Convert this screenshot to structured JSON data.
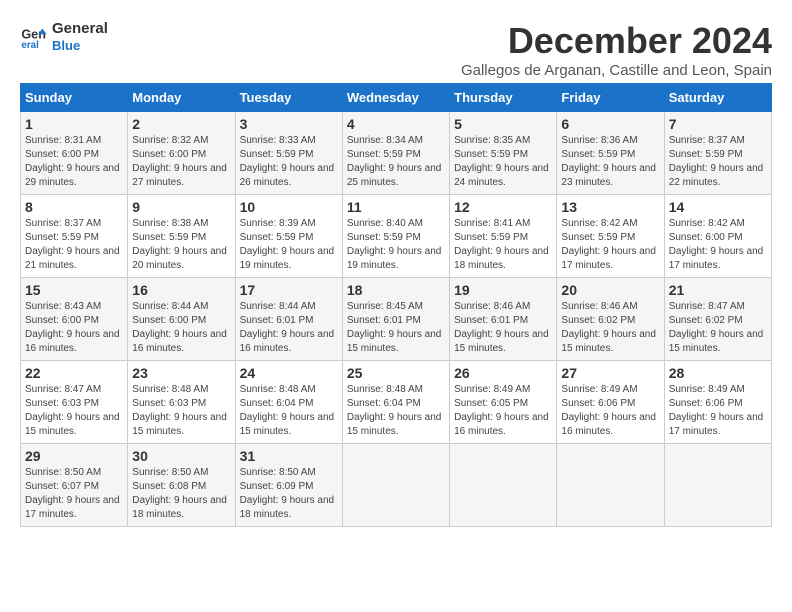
{
  "logo": {
    "line1": "General",
    "line2": "Blue"
  },
  "title": "December 2024",
  "subtitle": "Gallegos de Arganan, Castille and Leon, Spain",
  "weekdays": [
    "Sunday",
    "Monday",
    "Tuesday",
    "Wednesday",
    "Thursday",
    "Friday",
    "Saturday"
  ],
  "weeks": [
    [
      {
        "day": "1",
        "sunrise": "Sunrise: 8:31 AM",
        "sunset": "Sunset: 6:00 PM",
        "daylight": "Daylight: 9 hours and 29 minutes."
      },
      {
        "day": "2",
        "sunrise": "Sunrise: 8:32 AM",
        "sunset": "Sunset: 6:00 PM",
        "daylight": "Daylight: 9 hours and 27 minutes."
      },
      {
        "day": "3",
        "sunrise": "Sunrise: 8:33 AM",
        "sunset": "Sunset: 5:59 PM",
        "daylight": "Daylight: 9 hours and 26 minutes."
      },
      {
        "day": "4",
        "sunrise": "Sunrise: 8:34 AM",
        "sunset": "Sunset: 5:59 PM",
        "daylight": "Daylight: 9 hours and 25 minutes."
      },
      {
        "day": "5",
        "sunrise": "Sunrise: 8:35 AM",
        "sunset": "Sunset: 5:59 PM",
        "daylight": "Daylight: 9 hours and 24 minutes."
      },
      {
        "day": "6",
        "sunrise": "Sunrise: 8:36 AM",
        "sunset": "Sunset: 5:59 PM",
        "daylight": "Daylight: 9 hours and 23 minutes."
      },
      {
        "day": "7",
        "sunrise": "Sunrise: 8:37 AM",
        "sunset": "Sunset: 5:59 PM",
        "daylight": "Daylight: 9 hours and 22 minutes."
      }
    ],
    [
      {
        "day": "8",
        "sunrise": "Sunrise: 8:37 AM",
        "sunset": "Sunset: 5:59 PM",
        "daylight": "Daylight: 9 hours and 21 minutes."
      },
      {
        "day": "9",
        "sunrise": "Sunrise: 8:38 AM",
        "sunset": "Sunset: 5:59 PM",
        "daylight": "Daylight: 9 hours and 20 minutes."
      },
      {
        "day": "10",
        "sunrise": "Sunrise: 8:39 AM",
        "sunset": "Sunset: 5:59 PM",
        "daylight": "Daylight: 9 hours and 19 minutes."
      },
      {
        "day": "11",
        "sunrise": "Sunrise: 8:40 AM",
        "sunset": "Sunset: 5:59 PM",
        "daylight": "Daylight: 9 hours and 19 minutes."
      },
      {
        "day": "12",
        "sunrise": "Sunrise: 8:41 AM",
        "sunset": "Sunset: 5:59 PM",
        "daylight": "Daylight: 9 hours and 18 minutes."
      },
      {
        "day": "13",
        "sunrise": "Sunrise: 8:42 AM",
        "sunset": "Sunset: 5:59 PM",
        "daylight": "Daylight: 9 hours and 17 minutes."
      },
      {
        "day": "14",
        "sunrise": "Sunrise: 8:42 AM",
        "sunset": "Sunset: 6:00 PM",
        "daylight": "Daylight: 9 hours and 17 minutes."
      }
    ],
    [
      {
        "day": "15",
        "sunrise": "Sunrise: 8:43 AM",
        "sunset": "Sunset: 6:00 PM",
        "daylight": "Daylight: 9 hours and 16 minutes."
      },
      {
        "day": "16",
        "sunrise": "Sunrise: 8:44 AM",
        "sunset": "Sunset: 6:00 PM",
        "daylight": "Daylight: 9 hours and 16 minutes."
      },
      {
        "day": "17",
        "sunrise": "Sunrise: 8:44 AM",
        "sunset": "Sunset: 6:01 PM",
        "daylight": "Daylight: 9 hours and 16 minutes."
      },
      {
        "day": "18",
        "sunrise": "Sunrise: 8:45 AM",
        "sunset": "Sunset: 6:01 PM",
        "daylight": "Daylight: 9 hours and 15 minutes."
      },
      {
        "day": "19",
        "sunrise": "Sunrise: 8:46 AM",
        "sunset": "Sunset: 6:01 PM",
        "daylight": "Daylight: 9 hours and 15 minutes."
      },
      {
        "day": "20",
        "sunrise": "Sunrise: 8:46 AM",
        "sunset": "Sunset: 6:02 PM",
        "daylight": "Daylight: 9 hours and 15 minutes."
      },
      {
        "day": "21",
        "sunrise": "Sunrise: 8:47 AM",
        "sunset": "Sunset: 6:02 PM",
        "daylight": "Daylight: 9 hours and 15 minutes."
      }
    ],
    [
      {
        "day": "22",
        "sunrise": "Sunrise: 8:47 AM",
        "sunset": "Sunset: 6:03 PM",
        "daylight": "Daylight: 9 hours and 15 minutes."
      },
      {
        "day": "23",
        "sunrise": "Sunrise: 8:48 AM",
        "sunset": "Sunset: 6:03 PM",
        "daylight": "Daylight: 9 hours and 15 minutes."
      },
      {
        "day": "24",
        "sunrise": "Sunrise: 8:48 AM",
        "sunset": "Sunset: 6:04 PM",
        "daylight": "Daylight: 9 hours and 15 minutes."
      },
      {
        "day": "25",
        "sunrise": "Sunrise: 8:48 AM",
        "sunset": "Sunset: 6:04 PM",
        "daylight": "Daylight: 9 hours and 15 minutes."
      },
      {
        "day": "26",
        "sunrise": "Sunrise: 8:49 AM",
        "sunset": "Sunset: 6:05 PM",
        "daylight": "Daylight: 9 hours and 16 minutes."
      },
      {
        "day": "27",
        "sunrise": "Sunrise: 8:49 AM",
        "sunset": "Sunset: 6:06 PM",
        "daylight": "Daylight: 9 hours and 16 minutes."
      },
      {
        "day": "28",
        "sunrise": "Sunrise: 8:49 AM",
        "sunset": "Sunset: 6:06 PM",
        "daylight": "Daylight: 9 hours and 17 minutes."
      }
    ],
    [
      {
        "day": "29",
        "sunrise": "Sunrise: 8:50 AM",
        "sunset": "Sunset: 6:07 PM",
        "daylight": "Daylight: 9 hours and 17 minutes."
      },
      {
        "day": "30",
        "sunrise": "Sunrise: 8:50 AM",
        "sunset": "Sunset: 6:08 PM",
        "daylight": "Daylight: 9 hours and 18 minutes."
      },
      {
        "day": "31",
        "sunrise": "Sunrise: 8:50 AM",
        "sunset": "Sunset: 6:09 PM",
        "daylight": "Daylight: 9 hours and 18 minutes."
      },
      null,
      null,
      null,
      null
    ]
  ]
}
